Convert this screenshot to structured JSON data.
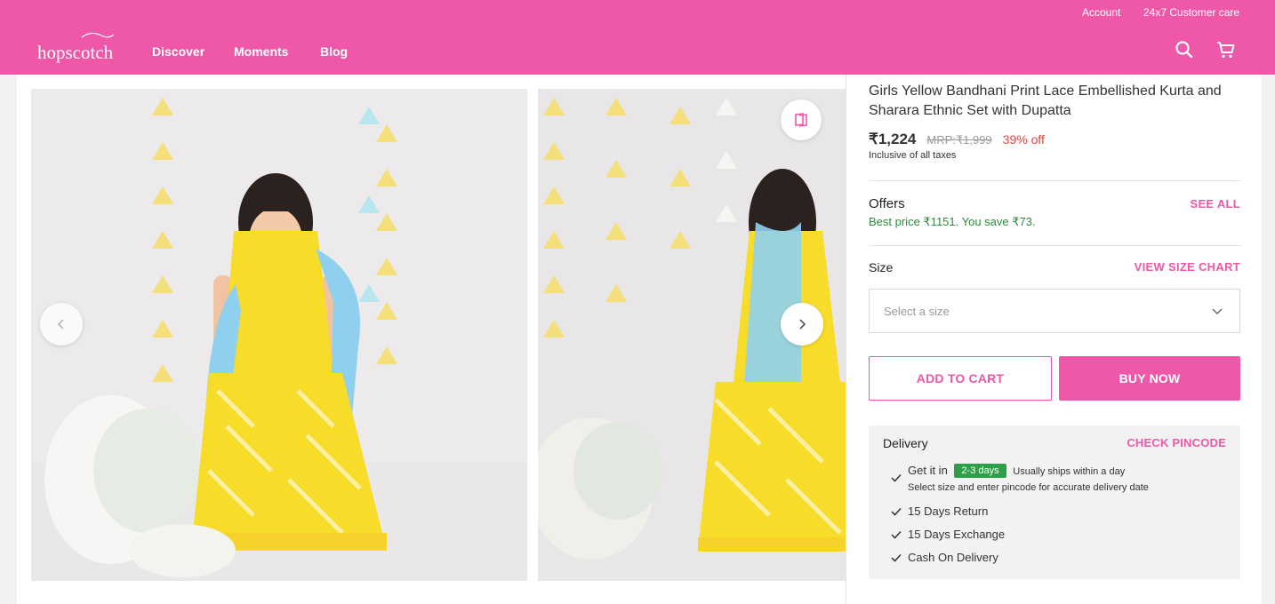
{
  "header": {
    "logo_text": "hopscotch",
    "account_label": "Account",
    "care_label": "24x7 Customer care",
    "nav": [
      "Discover",
      "Moments",
      "Blog"
    ],
    "icons": [
      "search-icon",
      "cart-icon"
    ],
    "brand_color": "#ef58a8"
  },
  "product": {
    "title": "Girls Yellow Bandhani Print Lace Embellished Kurta and Sharara Ethnic Set with Dupatta",
    "price": "₹1,224",
    "mrp": "MRP:₹1,999",
    "discount": "39% off",
    "tax_note": "Inclusive of all taxes"
  },
  "offers": {
    "label": "Offers",
    "see_all": "SEE ALL",
    "text": "Best price ₹1151. You save ₹73."
  },
  "size": {
    "label": "Size",
    "chart_link": "VIEW SIZE CHART",
    "placeholder": "Select a size"
  },
  "actions": {
    "add_to_cart": "ADD TO CART",
    "buy_now": "BUY NOW"
  },
  "delivery": {
    "label": "Delivery",
    "check_link": "CHECK PINCODE",
    "get_it_in": "Get it in",
    "days_badge": "2-3 days",
    "ships_note": "Usually ships within a day",
    "pincode_note": "Select size and enter pincode for accurate delivery date",
    "features": [
      "15 Days Return",
      "15 Days Exchange",
      "Cash On Delivery"
    ]
  },
  "gallery": {
    "icons": [
      "chevron-left-icon",
      "chevron-right-icon",
      "wishlist-icon"
    ]
  }
}
